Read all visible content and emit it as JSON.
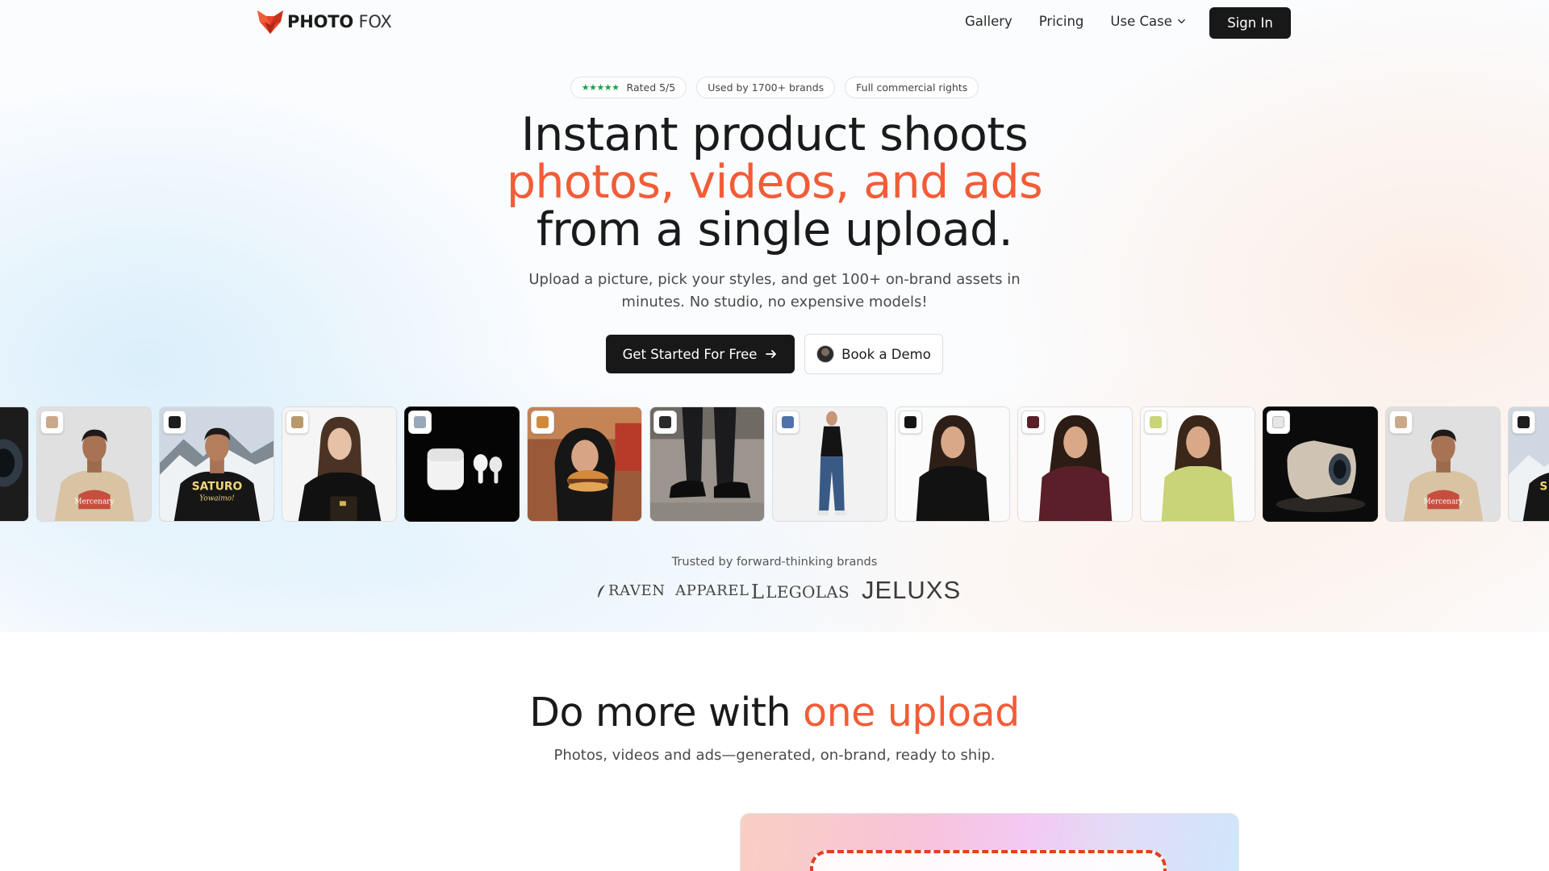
{
  "brand": {
    "name_bold": "PHOTO",
    "name_light": "FOX"
  },
  "nav": {
    "items": [
      "Gallery",
      "Pricing",
      "Use Case"
    ],
    "signin": "Sign In"
  },
  "hero": {
    "badges": {
      "rating_stars": "★★★★★",
      "rating": "Rated 5/5",
      "brands": "Used by 1700+ brands",
      "rights": "Full commercial rights"
    },
    "headline_line1": "Instant product shoots",
    "headline_line2": "photos, videos, and ads",
    "headline_line3": "from a single upload.",
    "subtext_line1": "Upload a picture, pick your styles, and get 100+ on-brand assets in",
    "subtext_line2": "minutes. No studio, no expensive models!",
    "cta_primary": "Get Started For Free",
    "cta_secondary": "Book a Demo"
  },
  "gallery": {
    "tiles": [
      {
        "subject": "projector-dark-partial"
      },
      {
        "subject": "man-beige-tshirt",
        "shirt_text_1": "Mercenary"
      },
      {
        "subject": "man-black-tshirt",
        "shirt_text_1": "SATURO",
        "shirt_text_2": "Yowaimo!"
      },
      {
        "subject": "woman-black-blazer-handbag"
      },
      {
        "subject": "white-earbuds-black-background"
      },
      {
        "subject": "woman-hijab-burger"
      },
      {
        "subject": "black-loafers-street"
      },
      {
        "subject": "man-black-tshirt-jeans"
      },
      {
        "subject": "woman-black-tshirt"
      },
      {
        "subject": "woman-maroon-tshirt"
      },
      {
        "subject": "woman-lime-tshirt"
      },
      {
        "subject": "white-projector-dark"
      },
      {
        "subject": "man-beige-tshirt",
        "shirt_text_1": "Mercenary"
      },
      {
        "subject": "man-black-tshirt-partial",
        "shirt_text_1": "S"
      }
    ]
  },
  "trusted": {
    "label": "Trusted by forward-thinking brands",
    "brands": [
      "RAVEN  APPAREL",
      "LEGOLAS",
      "JELUXS"
    ]
  },
  "section2": {
    "title_plain": "Do more with ",
    "title_accent": "one upload",
    "subtitle": "Photos, videos and ads—generated, on-brand, ready to ship."
  },
  "colors": {
    "accent": "#f25c37",
    "dark_button": "#181818",
    "star_green": "#18a34a"
  }
}
